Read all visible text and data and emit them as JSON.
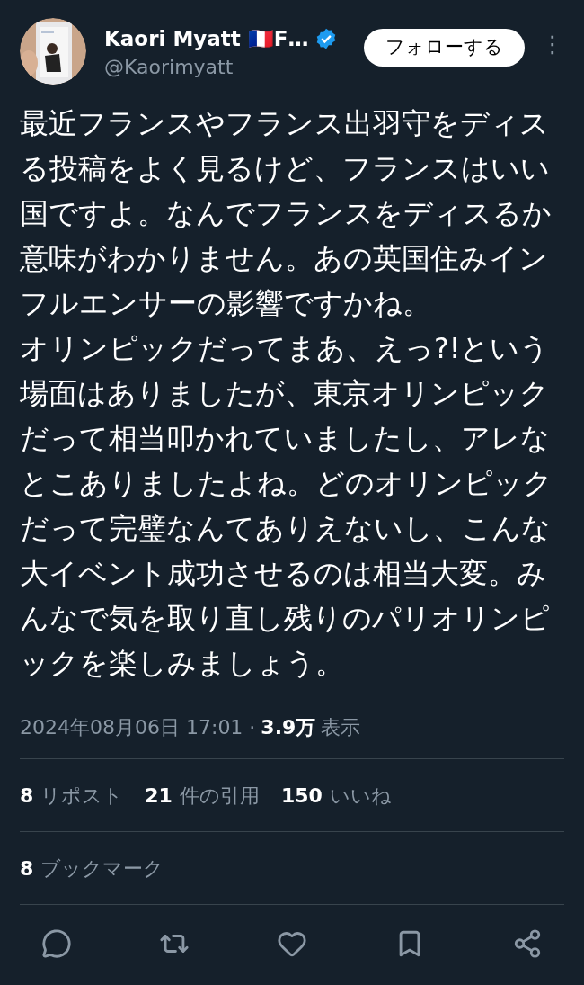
{
  "author": {
    "name": "Kaori Myatt 🇫🇷F…",
    "verified": true,
    "handle": "@Kaorimyatt"
  },
  "follow_button": "フォローする",
  "more_icon": "⋮",
  "body": [
    "最近フランスやフランス出羽守をディスる投稿をよく見るけど、フランスはいい国ですよ。なんでフランスをディスるか意味がわかりません。あの英国住みインフルエンサーの影響ですかね。",
    "オリンピックだってまあ、えっ?!という場面はありましたが、東京オリンピックだって相当叩かれていましたし、アレなとこありましたよね。どのオリンピックだって完璧なんてありえないし、こんな大イベント成功させるのは相当大変。みんなで気を取り直し残りのパリオリンピックを楽しみましょう。"
  ],
  "timestamp": "2024年08月06日 17:01 ·",
  "views": {
    "count": "3.9万",
    "label": "表示"
  },
  "stats": [
    {
      "count": "8",
      "label": "リポスト"
    },
    {
      "count": "21",
      "label": "件の引用"
    },
    {
      "count": "150",
      "label": "いいね"
    }
  ],
  "bookmarks": {
    "count": "8",
    "label": "ブックマーク"
  },
  "actions": [
    {
      "kind": "reply"
    },
    {
      "kind": "repost"
    },
    {
      "kind": "like"
    },
    {
      "kind": "bookmark"
    },
    {
      "kind": "share"
    }
  ]
}
